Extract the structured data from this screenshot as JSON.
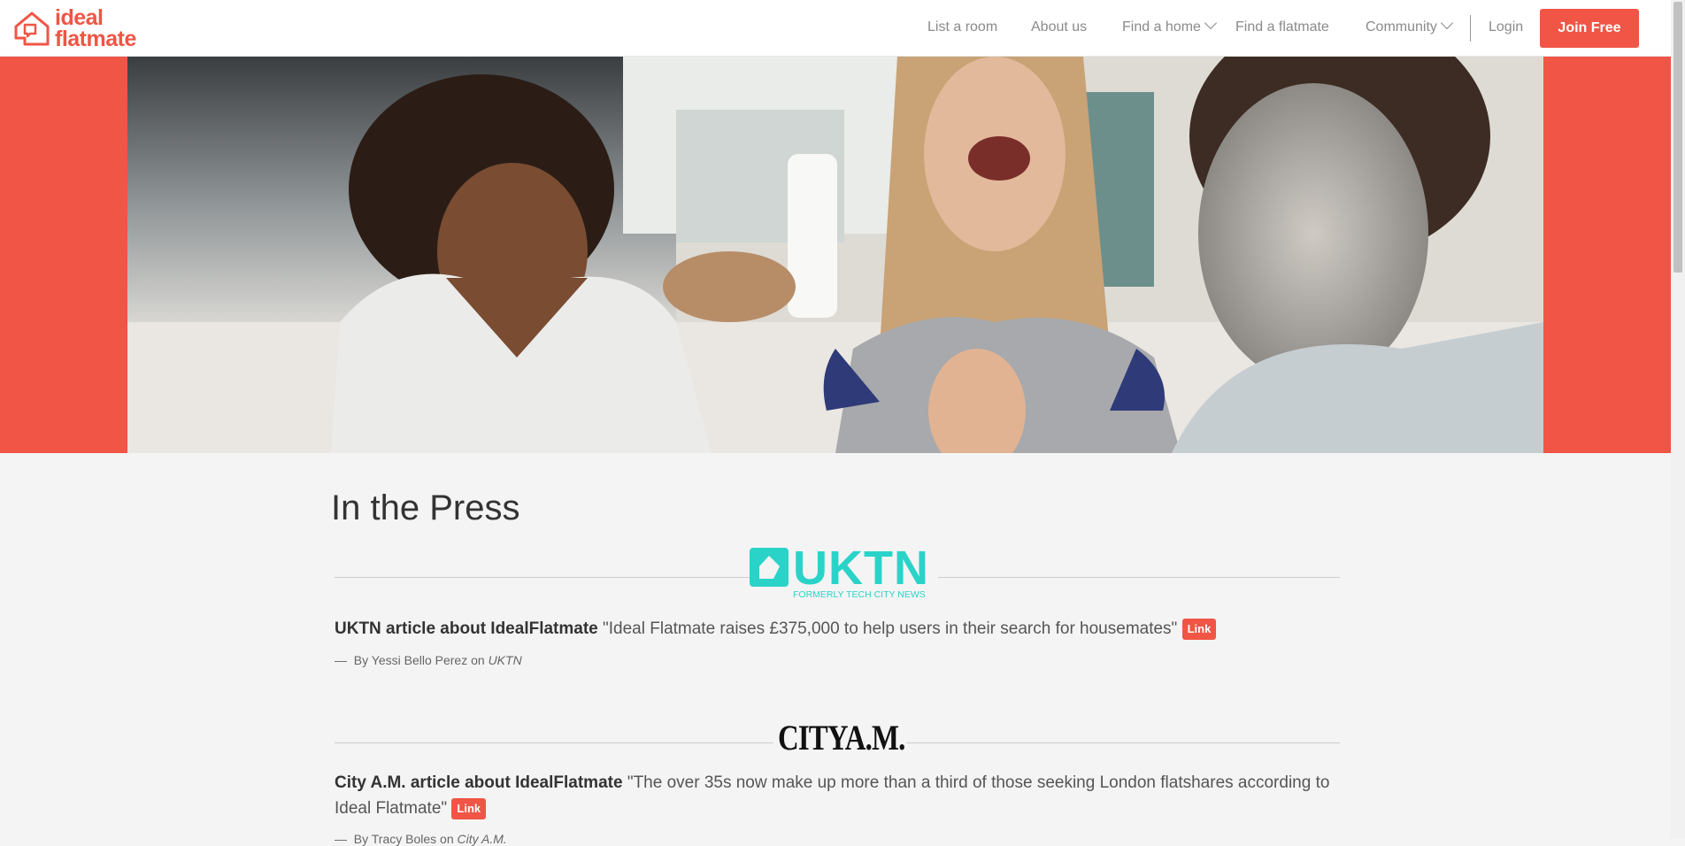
{
  "header": {
    "logo_line1": "ideal",
    "logo_line2": "flatmate",
    "nav": {
      "list_room": "List a room",
      "about": "About us",
      "find_home": "Find a home",
      "find_flatmate": "Find a flatmate",
      "community": "Community",
      "login": "Login",
      "join": "Join Free"
    }
  },
  "colors": {
    "brand": "#f05545",
    "uktn": "#2ad3c8",
    "background": "#f4f4f4"
  },
  "hero": {
    "image": "three-women-laughing-in-kitchen"
  },
  "page": {
    "title": "In the Press"
  },
  "press": [
    {
      "logo_text": "UKTN",
      "logo_sub": "FORMERLY TECH CITY NEWS",
      "source": "UKTN article about IdealFlatmate",
      "quote": "\"Ideal Flatmate raises £375,000 to help users in their search for housemates\"",
      "link_label": "Link",
      "dash": "—",
      "by": "By",
      "author": "Yessi Bello Perez",
      "on": "on",
      "outlet": "UKTN"
    },
    {
      "logo_text": "CITYA.M.",
      "source": "City A.M. article about IdealFlatmate",
      "quote": "\"The over 35s now make up more than a third of those seeking London flatshares according to Ideal Flatmate\"",
      "link_label": "Link",
      "dash": "—",
      "by": "By",
      "author": "Tracy Boles",
      "on": "on",
      "outlet": "City A.M."
    }
  ]
}
